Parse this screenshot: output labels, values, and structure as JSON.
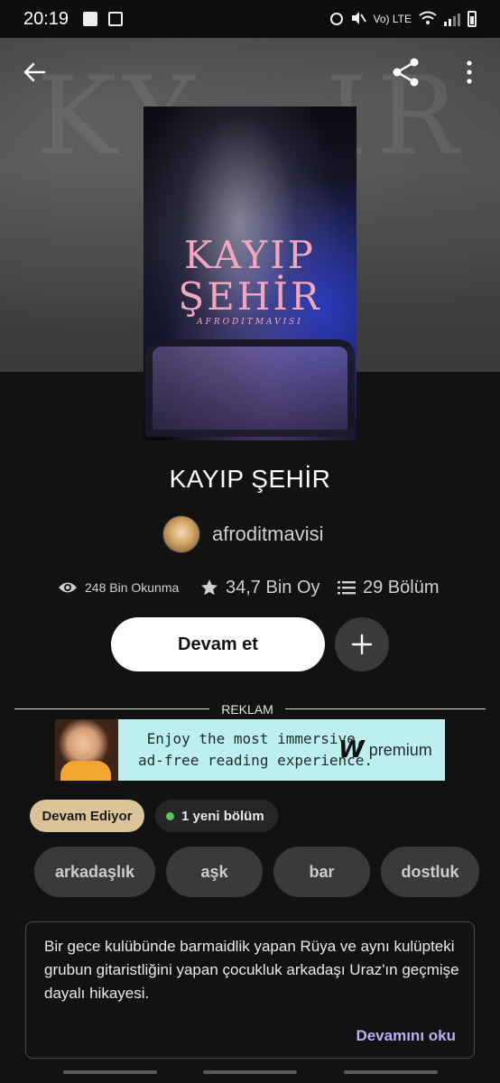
{
  "status_bar": {
    "time": "20:19",
    "network_label": "Vo) LTE"
  },
  "nav": {
    "back_icon": "arrow-left-icon",
    "share_icon": "share-icon",
    "more_icon": "more-vertical-icon"
  },
  "cover": {
    "title_line1": "KAYIP",
    "title_line2": "ŞEHİR",
    "author": "AFRODITMAVISI"
  },
  "book": {
    "title": "KAYIP ŞEHİR",
    "author": "afroditmavisi"
  },
  "stats": {
    "reads": "248 Bin Okunma",
    "votes": "34,7 Bin Oy",
    "parts": "29 Bölüm"
  },
  "actions": {
    "continue_label": "Devam et",
    "add_icon": "plus-icon"
  },
  "ad": {
    "label": "REKLAM",
    "line1": "Enjoy the most immersive,",
    "line2": "ad-free reading experience.",
    "brand": "premium",
    "brand_mark": "W"
  },
  "status": {
    "ongoing": "Devam Ediyor",
    "new_parts": "1 yeni bölüm",
    "ongoing_color": "#dbc39a",
    "new_dot_color": "#5cc25a"
  },
  "tags": [
    "arkadaşlık",
    "aşk",
    "bar",
    "dostluk"
  ],
  "description": {
    "text": "Bir gece kulübünde barmaidlik yapan Rüya ve aynı kulüpteki grubun gitaristliğini yapan çocukluk arkadaşı Uraz'ın geçmişe dayalı hikayesi.",
    "read_more": "Devamını oku",
    "read_more_color": "#b9aff2"
  }
}
